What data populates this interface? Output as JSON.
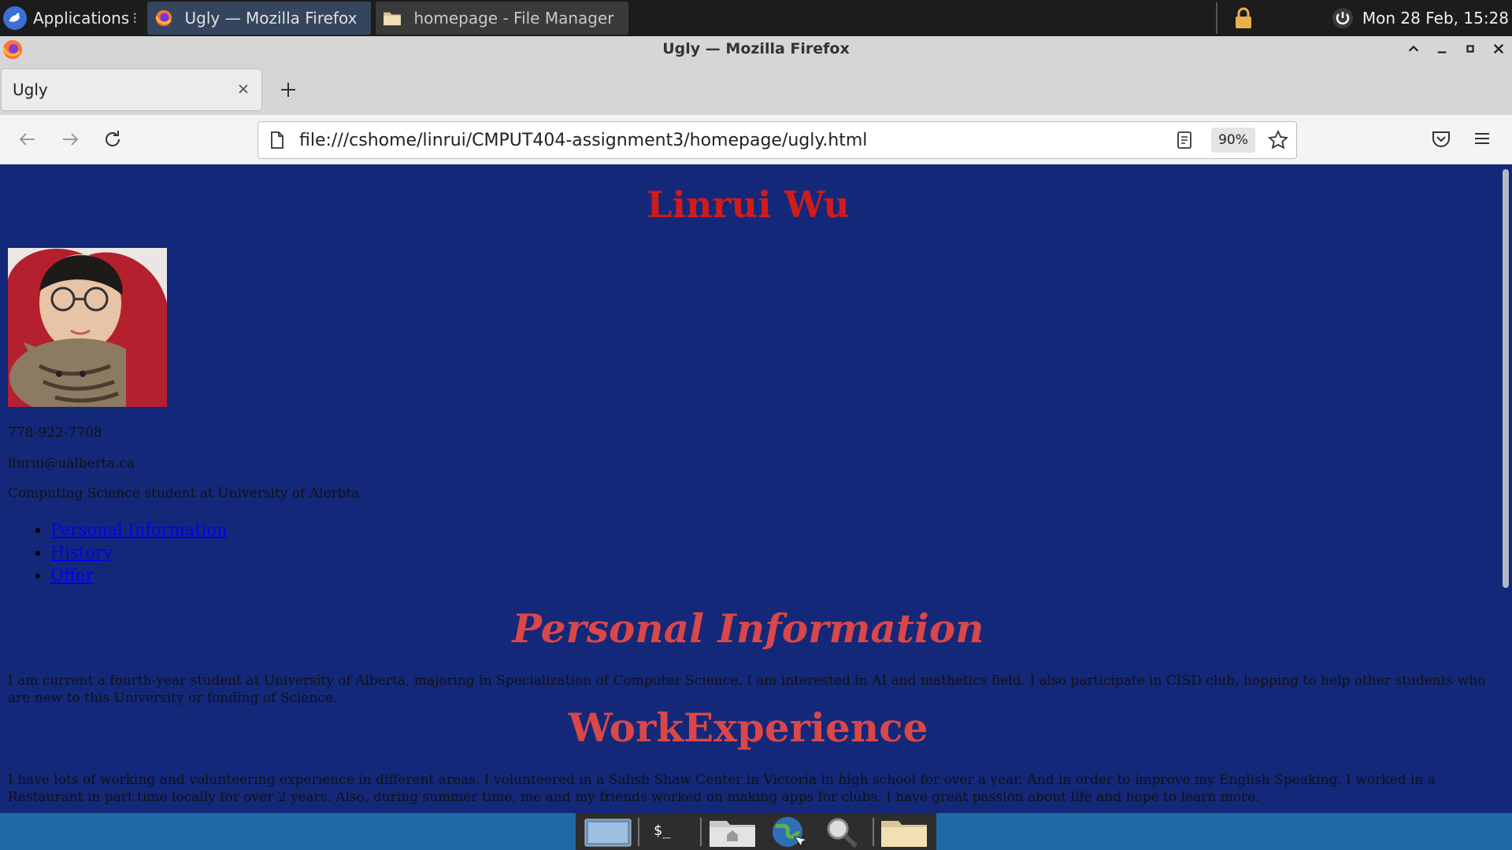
{
  "panel": {
    "applications_label": "Applications",
    "tasks": [
      {
        "label": "Ugly — Mozilla Firefox",
        "active": true
      },
      {
        "label": "homepage - File Manager",
        "active": false
      }
    ],
    "clock": "Mon 28 Feb, 15:28"
  },
  "window": {
    "title": "Ugly — Mozilla Firefox"
  },
  "browser": {
    "tab_title": "Ugly",
    "url": "file:///cshome/linrui/CMPUT404-assignment3/homepage/ugly.html",
    "zoom": "90%"
  },
  "page": {
    "name": "Linrui Wu",
    "phone": "778-922-7708",
    "email": "linrui@ualberta.ca",
    "tagline": "Computing Science student at University of Alerbta",
    "nav": [
      "Personal Information",
      "History",
      "Offer"
    ],
    "sections": [
      {
        "heading": "Personal Information",
        "text": "I am current a fourth-year student at University of Alberta, majoring in Specialization of Computer Science. I am interested in AI and mathetics field. I also participate in CISD club, hopping to help other students who are new to this University or fonding of Science."
      },
      {
        "heading": "WorkExperience",
        "text": "I have lots of working and volunteering experience in different areas. I volunteered in a Salish Shaw Center in Victoria in high school for over a year. And in order to improve my English Speaking, I worked in a Restaurant in part time locally for over 2 years. Also, during summer time, me and my friends worked on making apps for clubs. I have great passion about life and hope to learn more."
      }
    ]
  },
  "colors": {
    "page_background": "#142879",
    "name_color": "#d01b1b",
    "heading_color": "#d94748",
    "link_color": "#0000ee",
    "active_task": "#35455e"
  },
  "dock": {
    "icons": [
      "desktop-icon",
      "terminal-icon",
      "home-folder-icon",
      "web-browser-icon",
      "search-icon",
      "folder-icon"
    ]
  }
}
